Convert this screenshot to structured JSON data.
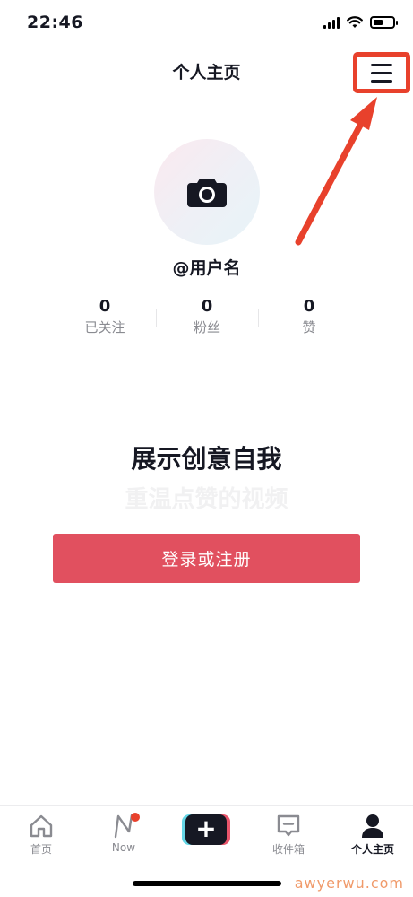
{
  "status_bar": {
    "time": "22:46"
  },
  "header": {
    "title": "个人主页",
    "menu_icon": "hamburger-icon"
  },
  "profile": {
    "username": "@用户名",
    "avatar_icon": "camera-icon",
    "stats": [
      {
        "value": "0",
        "label": "已关注"
      },
      {
        "value": "0",
        "label": "粉丝"
      },
      {
        "value": "0",
        "label": "赞"
      }
    ]
  },
  "prompt": {
    "headline": "展示创意自我",
    "subheadline": "重温点赞的视频",
    "login_label": "登录或注册"
  },
  "tab_bar": {
    "tabs": [
      {
        "label": "首页",
        "icon": "home-icon"
      },
      {
        "label": "Now",
        "icon": "now-icon"
      },
      {
        "label": "",
        "icon": "add-icon"
      },
      {
        "label": "收件箱",
        "icon": "inbox-icon"
      },
      {
        "label": "个人主页",
        "icon": "profile-icon"
      }
    ],
    "add_glyph": "+"
  },
  "watermark": "awyerwu.com",
  "colors": {
    "accent": "#e1505f",
    "highlight": "#e8412c",
    "text": "#161823",
    "muted": "#8a8b91"
  }
}
